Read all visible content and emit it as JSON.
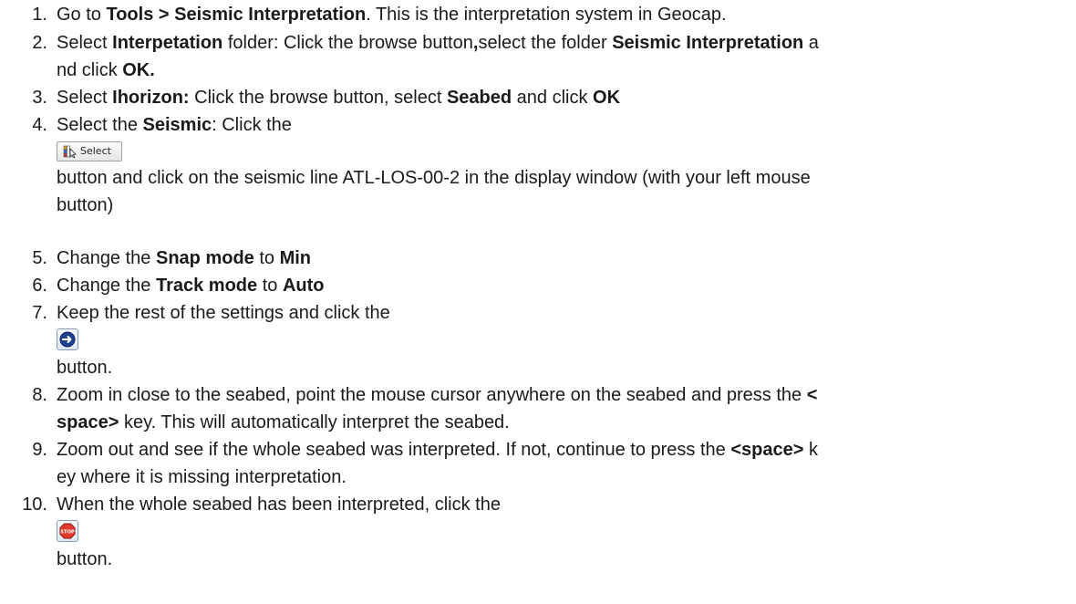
{
  "steps": [
    {
      "number": "1.",
      "pre": "Go to ",
      "bold": "Tools > Seismic Interpretation",
      "post": ". This is the interpretation system in Geocap."
    },
    {
      "number": "2.",
      "line1": {
        "a": "Select ",
        "b": "Interpetation",
        "c": " folder: Click the browse button",
        "d": ",",
        "e": "select the folder ",
        "f": "Seismic Interpretation",
        "g": " a"
      },
      "line2": {
        "a": "nd click ",
        "b": "OK."
      }
    },
    {
      "number": "3.",
      "a": "Select ",
      "b": "Ihorizon:",
      "c": " Click the browse button, select ",
      "d": "Seabed",
      "e": " and click ",
      "f": "OK"
    },
    {
      "number": "4.",
      "a": "Select the ",
      "b": "Seismic",
      "c": ": Click the",
      "button_label": "Select",
      "icon": "select-cursor-icon",
      "after_line1": "button and click on the seismic line ATL-LOS-00-2 in the display window (with your left mouse",
      "after_line2": "button)"
    },
    {
      "number": "5.",
      "a": "Change the ",
      "b": "Snap mode",
      "c": " to ",
      "d": "Min"
    },
    {
      "number": "6.",
      "a": "Change the ",
      "b": "Track mode",
      "c": " to ",
      "d": "Auto"
    },
    {
      "number": "7.",
      "text": "Keep the rest of the settings and click the",
      "icon": "arrow-right-circle-icon",
      "after": "button."
    },
    {
      "number": "8.",
      "line1": {
        "a": "Zoom in close to the seabed, point the mouse cursor anywhere on the seabed and press the ",
        "b": "<"
      },
      "line2": {
        "a": "space>",
        "b": " key. This will automatically interpret the seabed."
      }
    },
    {
      "number": "9.",
      "line1": {
        "a": "Zoom out and see if the whole seabed was interpreted. If not, continue to press the ",
        "b": "<space>",
        "c": " k"
      },
      "line2": "ey where it is missing interpretation."
    },
    {
      "number": "10.",
      "text": "When the whole seabed has been interpreted, click the",
      "icon": "stop-sign-icon",
      "icon_label": "STOP",
      "after": "button."
    }
  ],
  "colors": {
    "text": "#1a1a1a",
    "go_button_fill": "#1f3f8f",
    "stop_button_fill": "#e23b2e"
  }
}
